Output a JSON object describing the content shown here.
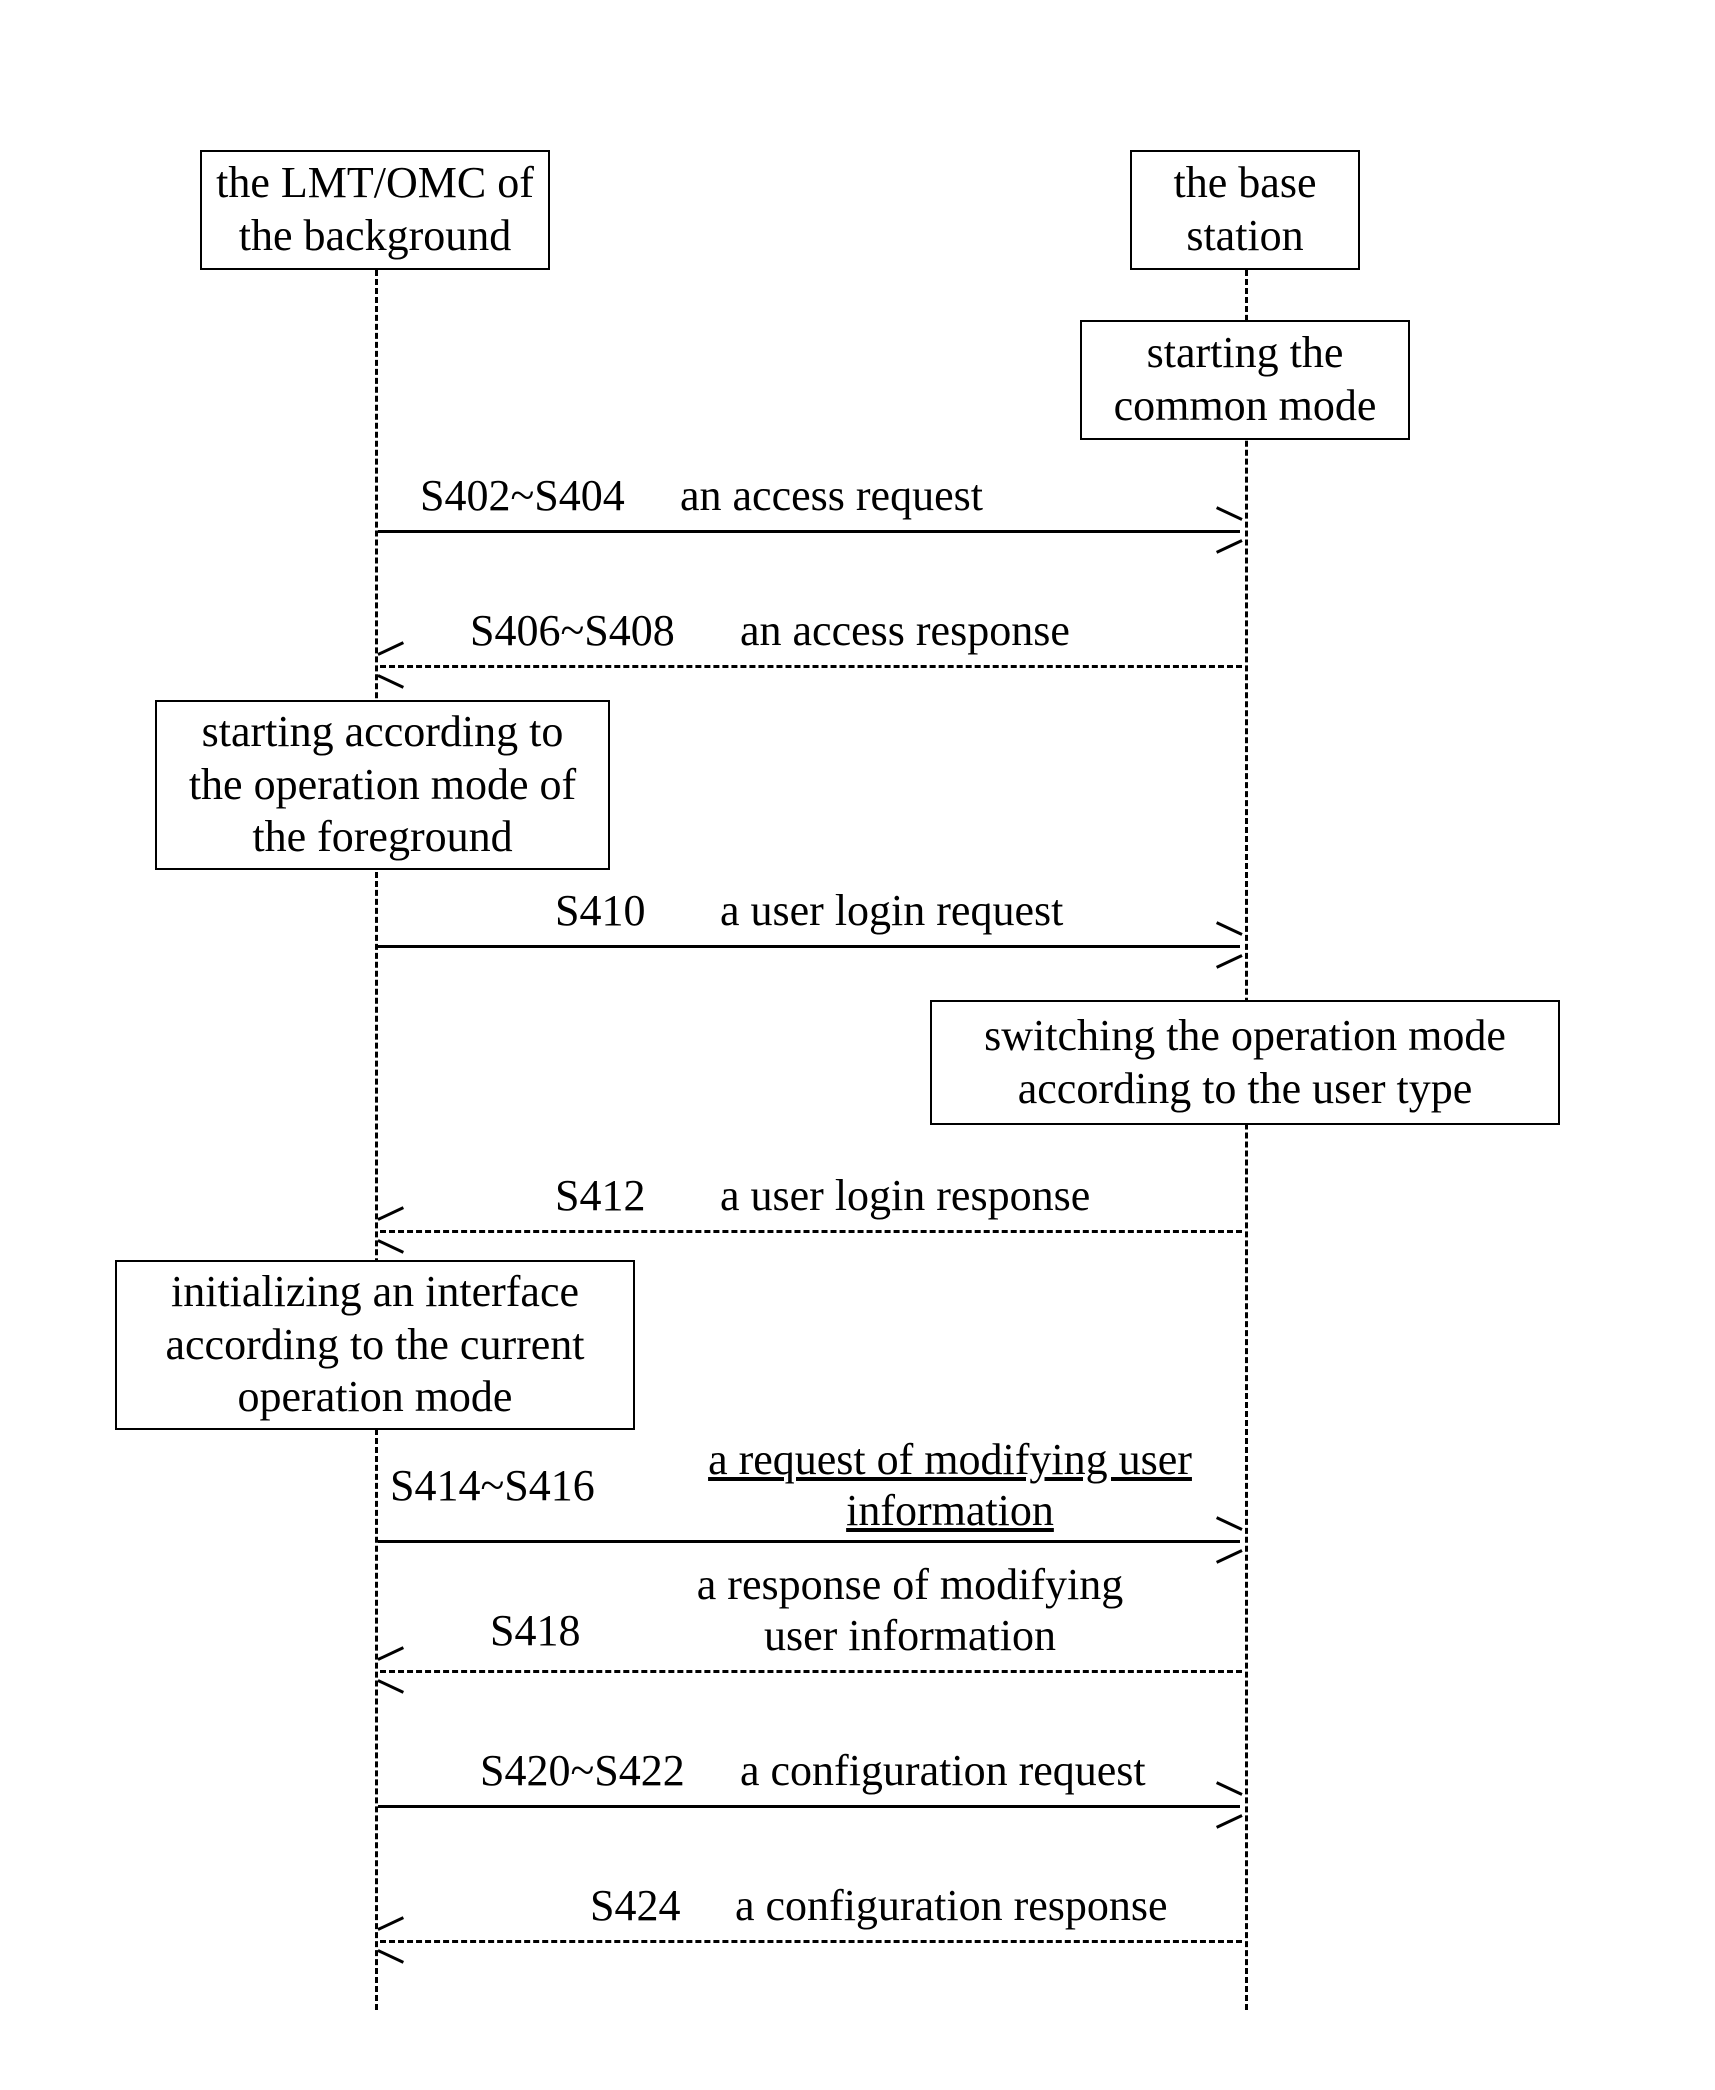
{
  "participants": {
    "left": "the LMT/OMC of\nthe background",
    "right": "the base\nstation"
  },
  "activations": {
    "start_common": "starting the\ncommon mode",
    "start_according": "starting according to\nthe operation mode of\nthe foreground",
    "switch_mode": "switching the operation mode\naccording to the user type",
    "init_interface": "initializing an interface\naccording to the current\noperation mode"
  },
  "messages": {
    "m1": {
      "step": "S402~S404",
      "text": "an access request"
    },
    "m2": {
      "step": "S406~S408",
      "text": "an access response"
    },
    "m3": {
      "step": "S410",
      "text": "a user login request"
    },
    "m4": {
      "step": "S412",
      "text": "a user login response"
    },
    "m5": {
      "step": "S414~S416",
      "text": "a request of modifying user\ninformation"
    },
    "m6": {
      "step": "S418",
      "text": "a response of modifying\nuser information"
    },
    "m7": {
      "step": "S420~S422",
      "text": "a configuration request"
    },
    "m8": {
      "step": "S424",
      "text": "a configuration response"
    }
  }
}
